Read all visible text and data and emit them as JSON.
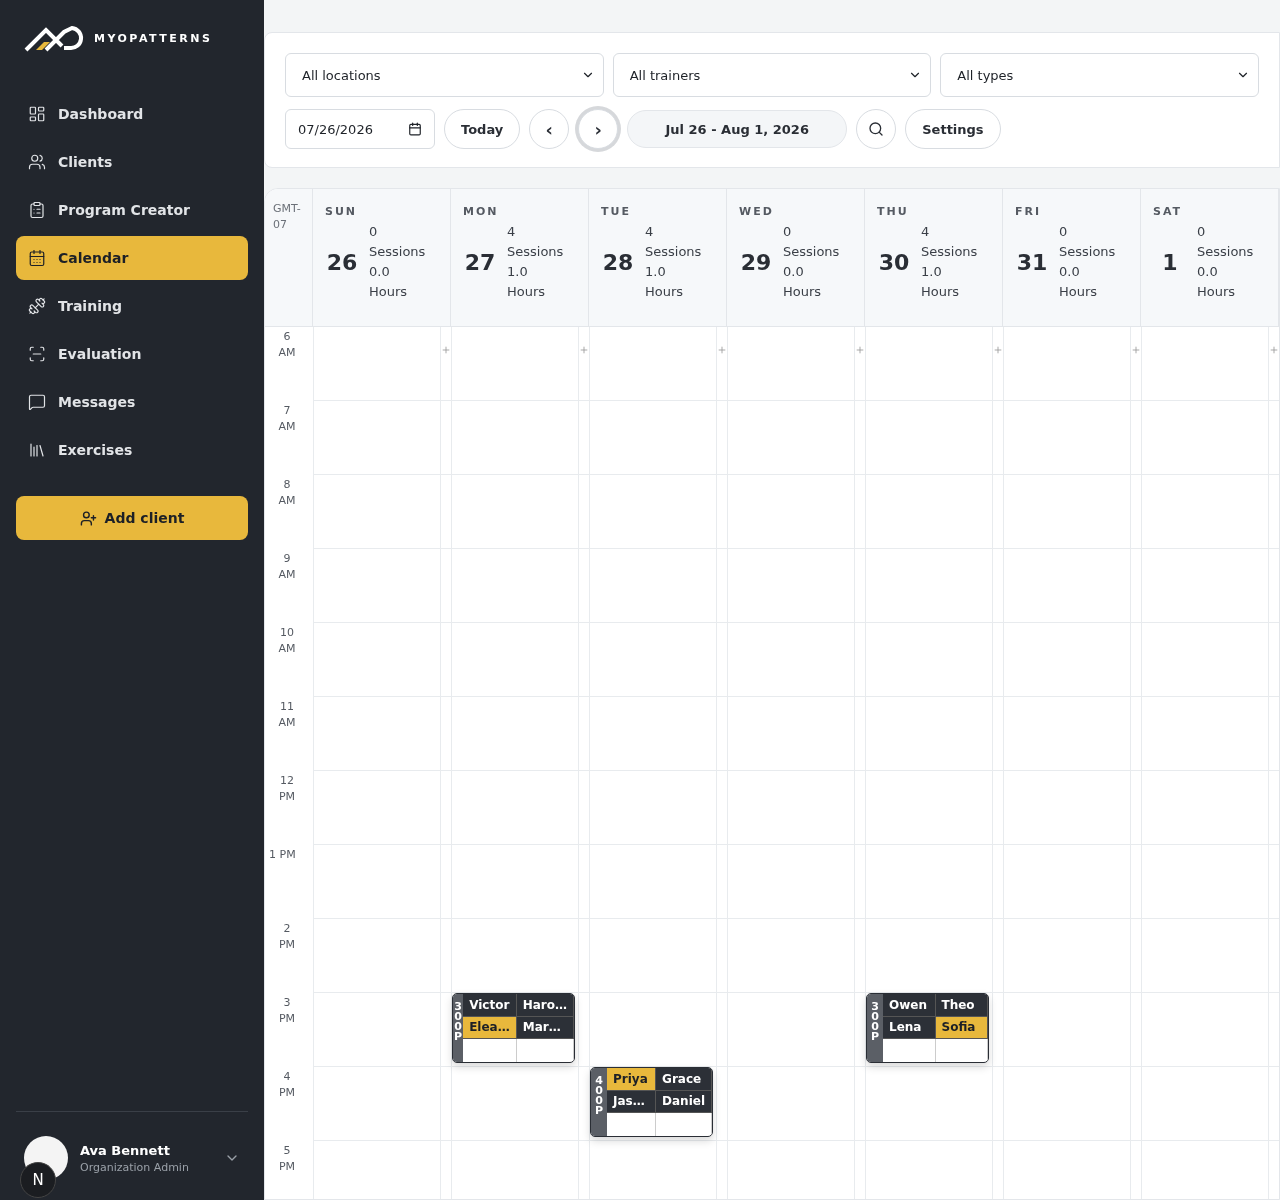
{
  "sidebar": {
    "brand": "MYOPATTERNS",
    "items": [
      {
        "label": "Dashboard",
        "selected": false
      },
      {
        "label": "Clients",
        "selected": false
      },
      {
        "label": "Program Creator",
        "selected": false
      },
      {
        "label": "Calendar",
        "selected": true
      },
      {
        "label": "Training",
        "selected": false
      },
      {
        "label": "Evaluation",
        "selected": false
      },
      {
        "label": "Messages",
        "selected": false
      },
      {
        "label": "Exercises",
        "selected": false
      }
    ],
    "add_button": "Add client",
    "user": {
      "name": "Ava Bennett",
      "role": "Organization Admin",
      "badge": "N"
    }
  },
  "filters": {
    "selects": [
      "All locations",
      "All trainers",
      "All types"
    ],
    "date": "07/26/2026",
    "today": "Today",
    "nav": [
      {
        "label": "‹",
        "focused": false
      },
      {
        "label": "›",
        "focused": true
      }
    ],
    "range": "Jul 26 - Aug 1, 2026",
    "settings": "Settings"
  },
  "calendar": {
    "timezone": "GMT-07",
    "days": [
      {
        "name": "SUN",
        "date": "26",
        "sessions": "0 Sessions",
        "hours": "0.0 Hours"
      },
      {
        "name": "MON",
        "date": "27",
        "sessions": "4 Sessions",
        "hours": "1.0 Hours"
      },
      {
        "name": "TUE",
        "date": "28",
        "sessions": "4 Sessions",
        "hours": "1.0 Hours"
      },
      {
        "name": "WED",
        "date": "29",
        "sessions": "0 Sessions",
        "hours": "0.0 Hours"
      },
      {
        "name": "THU",
        "date": "30",
        "sessions": "4 Sessions",
        "hours": "1.0 Hours"
      },
      {
        "name": "FRI",
        "date": "31",
        "sessions": "0 Sessions",
        "hours": "0.0 Hours"
      },
      {
        "name": "SAT",
        "date": "1",
        "sessions": "0 Sessions",
        "hours": "0.0 Hours"
      }
    ],
    "rows": [
      {
        "hour": "6",
        "period": "AM",
        "kind": "stacked",
        "cells": [
          {
            "kind": "empty"
          },
          {
            "kind": "empty"
          },
          {
            "kind": "empty"
          },
          {
            "kind": "empty"
          },
          {
            "kind": "empty"
          },
          {
            "kind": "empty"
          },
          {
            "kind": "empty"
          }
        ]
      },
      {
        "hour": "7",
        "period": "AM",
        "kind": "stacked",
        "cells": [
          {
            "kind": "empty"
          },
          {
            "kind": "empty"
          },
          {
            "kind": "empty"
          },
          {
            "kind": "empty"
          },
          {
            "kind": "empty"
          },
          {
            "kind": "empty"
          },
          {
            "kind": "empty"
          }
        ]
      },
      {
        "hour": "8",
        "period": "AM",
        "kind": "stacked",
        "cells": [
          {
            "kind": "empty"
          },
          {
            "kind": "empty"
          },
          {
            "kind": "empty"
          },
          {
            "kind": "empty"
          },
          {
            "kind": "empty"
          },
          {
            "kind": "empty"
          },
          {
            "kind": "empty"
          }
        ]
      },
      {
        "hour": "9",
        "period": "AM",
        "kind": "stacked",
        "cells": [
          {
            "kind": "empty"
          },
          {
            "kind": "empty"
          },
          {
            "kind": "empty"
          },
          {
            "kind": "empty"
          },
          {
            "kind": "empty"
          },
          {
            "kind": "empty"
          },
          {
            "kind": "empty"
          }
        ]
      },
      {
        "hour": "10",
        "period": "AM",
        "kind": "stacked",
        "cells": [
          {
            "kind": "empty"
          },
          {
            "kind": "empty"
          },
          {
            "kind": "empty"
          },
          {
            "kind": "empty"
          },
          {
            "kind": "empty"
          },
          {
            "kind": "empty"
          },
          {
            "kind": "empty"
          }
        ]
      },
      {
        "hour": "11",
        "period": "AM",
        "kind": "stacked",
        "cells": [
          {
            "kind": "empty"
          },
          {
            "kind": "empty"
          },
          {
            "kind": "empty"
          },
          {
            "kind": "empty"
          },
          {
            "kind": "empty"
          },
          {
            "kind": "empty"
          },
          {
            "kind": "empty"
          }
        ]
      },
      {
        "hour": "12",
        "period": "PM",
        "kind": "stacked",
        "cells": [
          {
            "kind": "empty"
          },
          {
            "kind": "empty"
          },
          {
            "kind": "empty"
          },
          {
            "kind": "empty"
          },
          {
            "kind": "empty"
          },
          {
            "kind": "empty"
          },
          {
            "kind": "empty"
          }
        ]
      },
      {
        "hour": "1",
        "period": "PM",
        "kind": "inline",
        "cells": [
          {
            "kind": "empty"
          },
          {
            "kind": "empty"
          },
          {
            "kind": "empty"
          },
          {
            "kind": "empty"
          },
          {
            "kind": "empty"
          },
          {
            "kind": "empty"
          },
          {
            "kind": "empty"
          }
        ]
      },
      {
        "hour": "2",
        "period": "PM",
        "kind": "stacked",
        "cells": [
          {
            "kind": "empty"
          },
          {
            "kind": "empty"
          },
          {
            "kind": "empty"
          },
          {
            "kind": "empty"
          },
          {
            "kind": "empty"
          },
          {
            "kind": "empty"
          },
          {
            "kind": "empty"
          }
        ]
      },
      {
        "hour": "3",
        "period": "PM",
        "kind": "stacked",
        "cells": [
          {
            "kind": "empty"
          },
          {
            "kind": "session",
            "time": [
              "3",
              "0",
              "0",
              "P"
            ],
            "attendees": [
              {
                "name": "Victor",
                "highlighted": false
              },
              {
                "name": "Haro…",
                "highlighted": false
              },
              {
                "name": "Elea…",
                "highlighted": true
              },
              {
                "name": "Mar…",
                "highlighted": false
              }
            ]
          },
          {
            "kind": "empty"
          },
          {
            "kind": "empty"
          },
          {
            "kind": "session",
            "time": [
              "3",
              "0",
              "0",
              "P"
            ],
            "attendees": [
              {
                "name": "Owen",
                "highlighted": false
              },
              {
                "name": "Theo",
                "highlighted": false
              },
              {
                "name": "Lena",
                "highlighted": false
              },
              {
                "name": "Sofia",
                "highlighted": true
              }
            ]
          },
          {
            "kind": "empty"
          },
          {
            "kind": "empty"
          }
        ]
      },
      {
        "hour": "4",
        "period": "PM",
        "kind": "stacked",
        "cells": [
          {
            "kind": "empty"
          },
          {
            "kind": "empty"
          },
          {
            "kind": "session",
            "time": [
              "4",
              "0",
              "0",
              "P"
            ],
            "attendees": [
              {
                "name": "Priya",
                "highlighted": true
              },
              {
                "name": "Grace",
                "highlighted": false
              },
              {
                "name": "Jas…",
                "highlighted": false
              },
              {
                "name": "Daniel",
                "highlighted": false
              }
            ]
          },
          {
            "kind": "empty"
          },
          {
            "kind": "empty"
          },
          {
            "kind": "empty"
          },
          {
            "kind": "empty"
          }
        ]
      },
      {
        "hour": "5",
        "period": "PM",
        "kind": "stacked",
        "cells": [
          {
            "kind": "empty"
          },
          {
            "kind": "empty"
          },
          {
            "kind": "empty"
          },
          {
            "kind": "empty"
          },
          {
            "kind": "empty"
          },
          {
            "kind": "empty"
          },
          {
            "kind": "empty"
          }
        ]
      }
    ]
  }
}
